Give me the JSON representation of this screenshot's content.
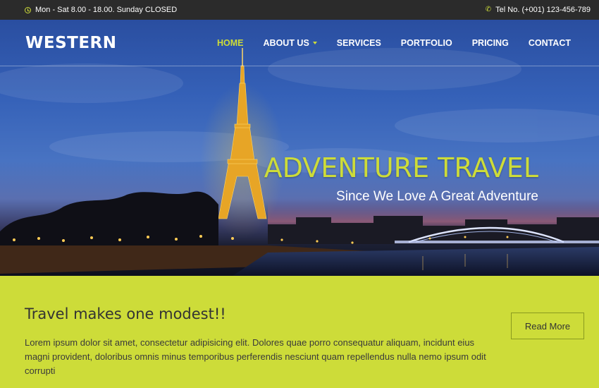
{
  "topbar": {
    "hours": "Mon - Sat 8.00 - 18.00. Sunday CLOSED",
    "phone": "Tel No. (+001) 123-456-789"
  },
  "header": {
    "logo": "WESTERN",
    "nav": [
      {
        "label": "HOME",
        "active": true
      },
      {
        "label": "ABOUT US",
        "dropdown": true
      },
      {
        "label": "SERVICES"
      },
      {
        "label": "PORTFOLIO"
      },
      {
        "label": "PRICING"
      },
      {
        "label": "CONTACT"
      }
    ]
  },
  "hero": {
    "title": "ADVENTURE TRAVEL",
    "subtitle": "Since We Love A Great Adventure"
  },
  "content": {
    "heading": "Travel makes one modest!!",
    "body": "Lorem ipsum dolor sit amet, consectetur adipisicing elit. Dolores quae porro consequatur aliquam, incidunt eius magni provident, doloribus omnis minus temporibus perferendis nesciunt quam repellendus nulla nemo ipsum odit corrupti",
    "button": "Read More"
  },
  "colors": {
    "accent": "#cddc39",
    "topbar": "#2b2b2b"
  },
  "icons": {
    "hours": "clock-icon",
    "phone": "phone-icon",
    "dropdown": "caret-down-icon"
  }
}
